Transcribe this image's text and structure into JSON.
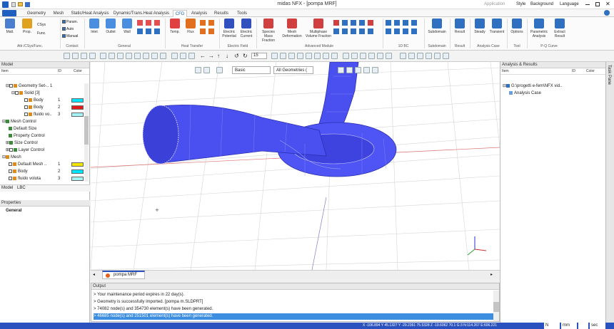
{
  "title": "midas NFX - [pompa MRF]",
  "title_right": {
    "application": "Application",
    "style": "Style",
    "background": "Background",
    "language": "Language"
  },
  "tabs": [
    "Geometry",
    "Mesh",
    "Static/Heat Analysis",
    "Dynamic/Trans.Heat Analysis",
    "CFD",
    "Analysis",
    "Results",
    "Tools"
  ],
  "active_tab": "CFD",
  "ribbon": {
    "buttons": [
      {
        "label": "Matl.",
        "icon": "material-icon",
        "color": "#4a7fcf"
      },
      {
        "label": "Prop.",
        "icon": "property-icon",
        "color": "#e0a020"
      },
      {
        "label": "CSys",
        "icon": "csys-icon",
        "color": "#c04040"
      },
      {
        "label": "Func.",
        "icon": "function-icon",
        "color": "#6060c0"
      },
      {
        "label": "Param.",
        "icon": "param-icon",
        "color": "#3070c0"
      },
      {
        "label": "Auto",
        "icon": "auto-icon",
        "color": "#3070c0"
      },
      {
        "label": "Manual",
        "icon": "manual-icon",
        "color": "#3070c0"
      },
      {
        "label": "Inlet",
        "icon": "inlet-icon",
        "color": "#4a8fdf"
      },
      {
        "label": "Outlet",
        "icon": "outlet-icon",
        "color": "#4a8fdf"
      },
      {
        "label": "Wall",
        "icon": "wall-icon",
        "color": "#4a8fdf"
      },
      {
        "label": "Temp.",
        "icon": "temperature-icon",
        "color": "#e04040"
      },
      {
        "label": "Flux",
        "icon": "flux-icon",
        "color": "#e07020"
      },
      {
        "label": "Electric Potential",
        "icon": "potential-icon",
        "color": "#3050c0"
      },
      {
        "label": "Electric Current",
        "icon": "current-icon",
        "color": "#3050c0"
      },
      {
        "label": "Species Mass Fraction",
        "icon": "species-icon",
        "color": "#d04040"
      },
      {
        "label": "Mesh Deformation",
        "icon": "mesh-deformation-icon",
        "color": "#d04040"
      },
      {
        "label": "Multiphase Volume Fraction",
        "icon": "multiphase-icon",
        "color": "#d04040"
      },
      {
        "label": "Subdomain",
        "icon": "subdomain-icon",
        "color": "#3070c0"
      },
      {
        "label": "Result",
        "icon": "result-icon",
        "color": "#3070c0"
      },
      {
        "label": "Steady",
        "icon": "steady-icon",
        "color": "#3070c0"
      },
      {
        "label": "Transient",
        "icon": "transient-icon",
        "color": "#3070c0"
      },
      {
        "label": "Options",
        "icon": "options-icon",
        "color": "#3070c0"
      },
      {
        "label": "Parametric Analysis",
        "icon": "parametric-icon",
        "color": "#3070c0"
      },
      {
        "label": "Extract Result",
        "icon": "extract-icon",
        "color": "#3070c0"
      }
    ],
    "groups": [
      "Attr./CSys/Func.",
      "Contact",
      "General",
      "Heat Transfer",
      "Electric Field",
      "Advanced Module",
      "1D BC",
      "Subdomain",
      "Result",
      "Analysis Case",
      "Tool",
      "P-Q Curve"
    ]
  },
  "toolbar": {
    "count": "15"
  },
  "viewport_toolbar": {
    "display_mode": "Basic",
    "filter": "All Geometries ("
  },
  "model_panel": {
    "header": "Model",
    "columns": {
      "item": "Item",
      "id": "ID",
      "color": "Color"
    },
    "rows": [
      {
        "label": "Geometry Set-.. 1",
        "id": "",
        "color": ""
      },
      {
        "label": "Solid [3]",
        "id": "",
        "color": ""
      },
      {
        "label": "Body",
        "id": "1",
        "color": "#00e5ff"
      },
      {
        "label": "Body",
        "id": "2",
        "color": "#e41b1b"
      },
      {
        "label": "fluido vo..",
        "id": "3",
        "color": "#a5f3f5"
      },
      {
        "label": "Mesh Control",
        "id": "",
        "color": ""
      },
      {
        "label": "Default Size",
        "id": "",
        "color": ""
      },
      {
        "label": "Property Control",
        "id": "",
        "color": ""
      },
      {
        "label": "Size Control",
        "id": "",
        "color": ""
      },
      {
        "label": "Layer Control",
        "id": "",
        "color": ""
      },
      {
        "label": "Mesh",
        "id": "",
        "color": ""
      },
      {
        "label": "Default Mesh ..",
        "id": "1",
        "color": "#f2e600"
      },
      {
        "label": "Body",
        "id": "2",
        "color": "#00e5ff"
      },
      {
        "label": "fluido voluta",
        "id": "3",
        "color": "#a5f3f5"
      }
    ],
    "tabs": [
      "Model",
      "LBC"
    ]
  },
  "properties_panel": {
    "header": "Properties",
    "section": "General"
  },
  "document_tab": "pompa MRF",
  "output": {
    "header": "Output",
    "lines": [
      "> Your maintenance period expires in 22 day(s).",
      "> Geometry is successfully imported. [pompa m.SLDPRT]",
      "> 74082 node(s) and 354730 element(s) have been generated.",
      "> 46685 node(s) and 251501 element(s) have been generated."
    ]
  },
  "analysis_panel": {
    "header": "Analysis & Results",
    "columns": {
      "item": "Item",
      "id": "ID",
      "color": "Color"
    },
    "rows": [
      "G:\\progetti e-fem\\NFX vid..",
      "Analysis Case"
    ]
  },
  "task_pane": "Task Pane",
  "statusbar": {
    "coords": "X -106.894 Y 45.1327 Y -29.2361 75.5328 Z -19.6062 70.1 G:3 N:114.267 E:606.221",
    "unit_force": "N",
    "unit_length": "mm",
    "unit_time": "sec"
  }
}
